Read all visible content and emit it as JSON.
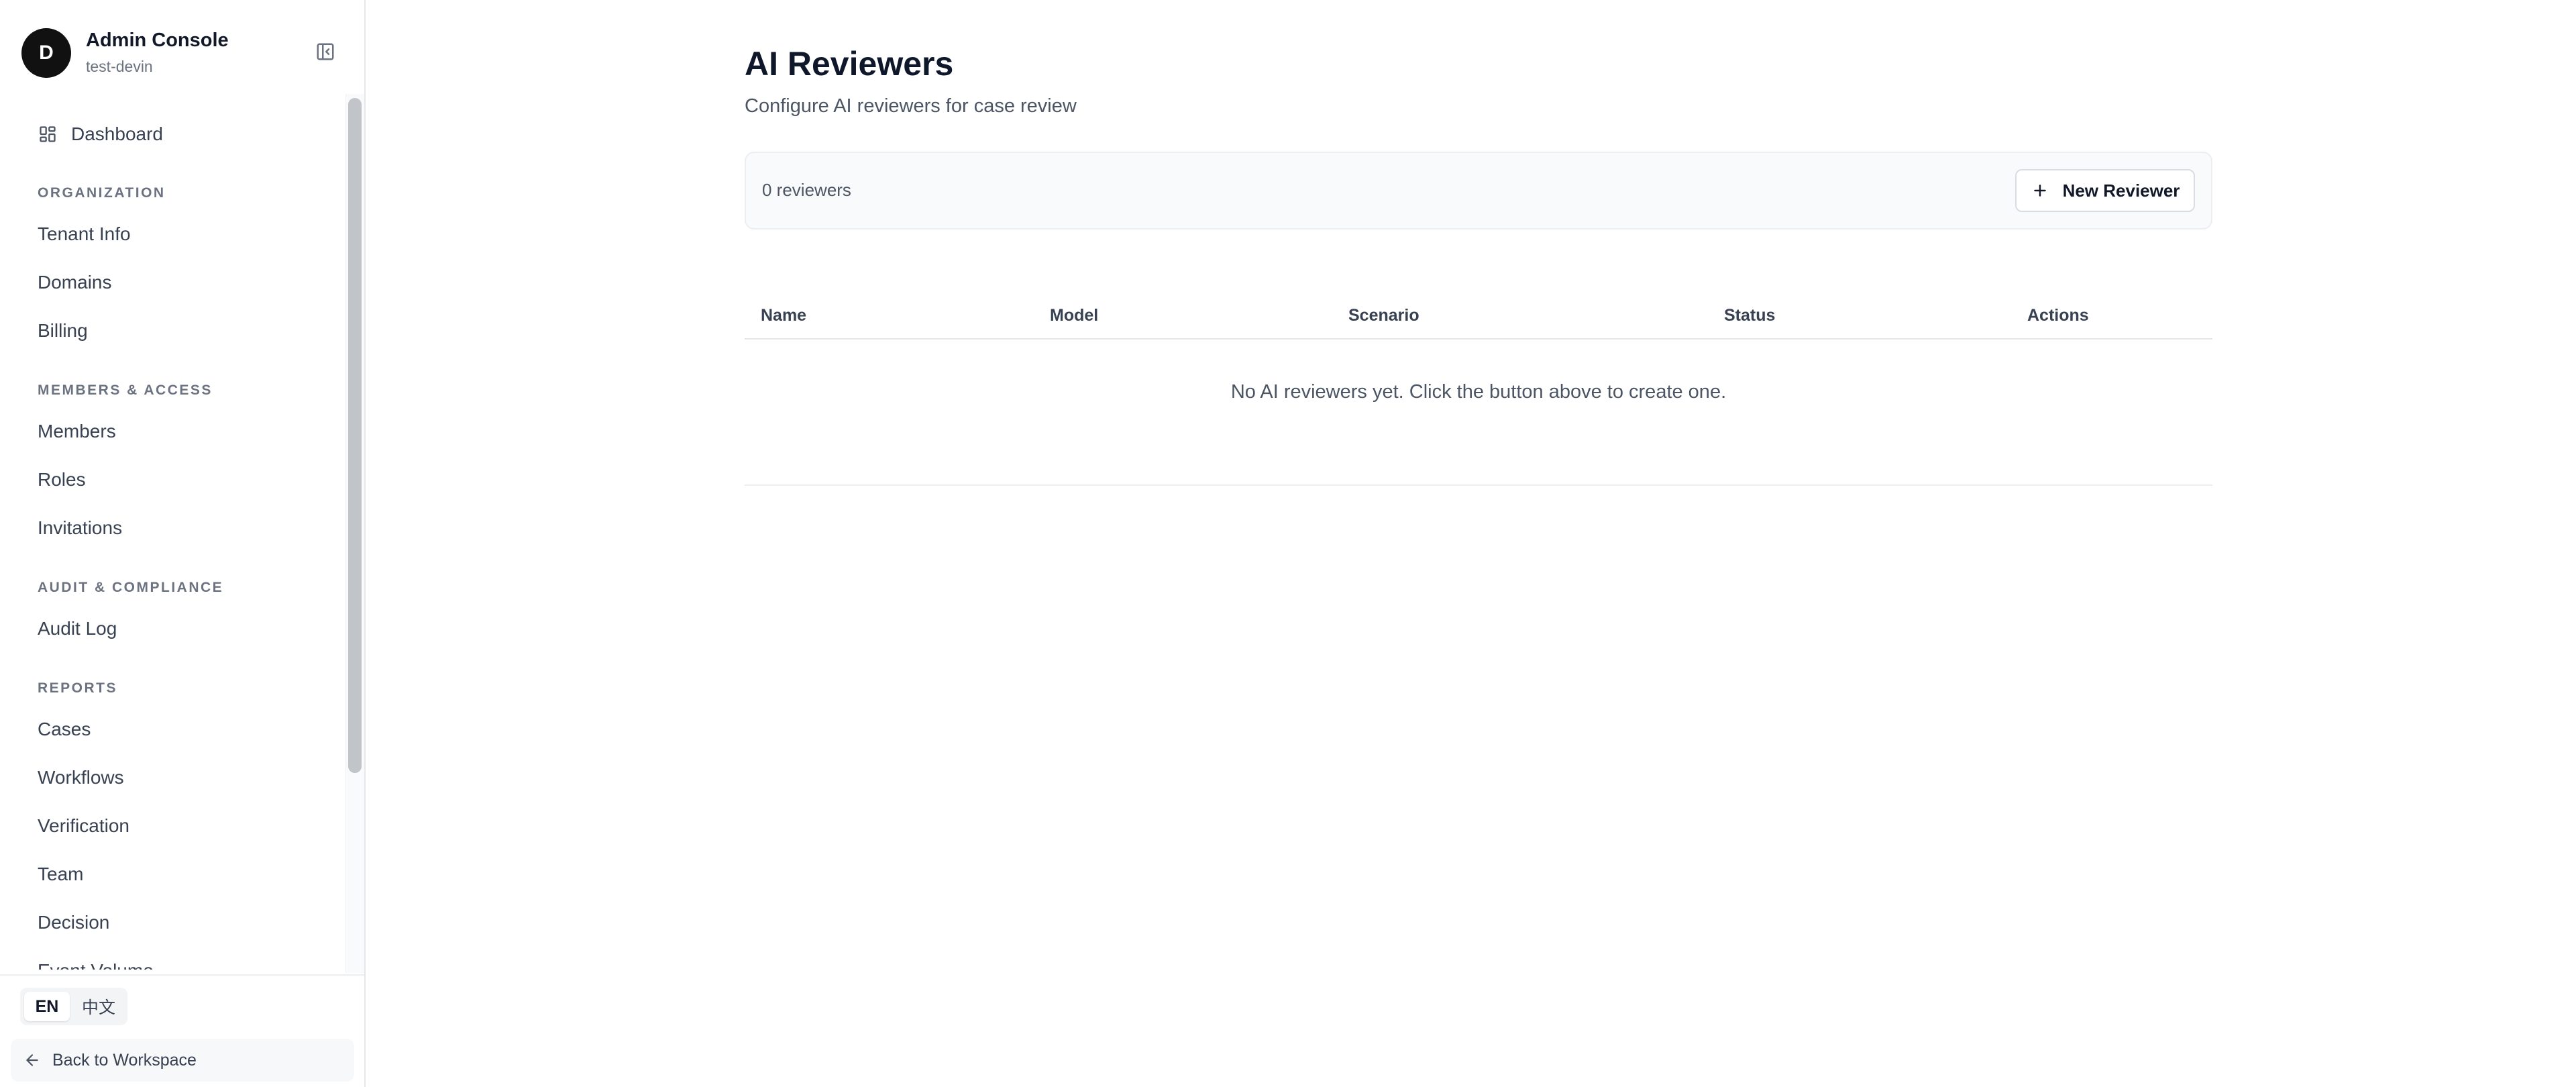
{
  "sidebar": {
    "avatar_initial": "D",
    "title": "Admin Console",
    "subtitle": "test-devin",
    "dashboard_label": "Dashboard",
    "sections": {
      "organization": {
        "label": "ORGANIZATION",
        "items": [
          "Tenant Info",
          "Domains",
          "Billing"
        ]
      },
      "members": {
        "label": "MEMBERS & ACCESS",
        "items": [
          "Members",
          "Roles",
          "Invitations"
        ]
      },
      "audit": {
        "label": "AUDIT & COMPLIANCE",
        "items": [
          "Audit Log"
        ]
      },
      "reports": {
        "label": "REPORTS",
        "items": [
          "Cases",
          "Workflows",
          "Verification",
          "Team",
          "Decision",
          "Event Volume"
        ]
      }
    },
    "languages": {
      "en": "EN",
      "zh": "中文",
      "active": "EN"
    },
    "back_label": "Back to Workspace"
  },
  "main": {
    "title": "AI Reviewers",
    "subtitle": "Configure AI reviewers for case review",
    "count_label": "0 reviewers",
    "new_button_label": "New Reviewer",
    "table": {
      "columns": [
        "Name",
        "Model",
        "Scenario",
        "Status",
        "Actions"
      ],
      "empty_message": "No AI reviewers yet. Click the button above to create one."
    }
  },
  "icons": {
    "collapse": "sidebar-collapse-icon",
    "dashboard": "grid-icon",
    "back": "arrow-left-icon",
    "add": "plus-icon"
  },
  "colors": {
    "text_primary": "#111827",
    "text_secondary": "#4b5563",
    "border": "#e5e7eb",
    "panel_bg": "#f9fafb",
    "avatar_bg": "#111111"
  }
}
